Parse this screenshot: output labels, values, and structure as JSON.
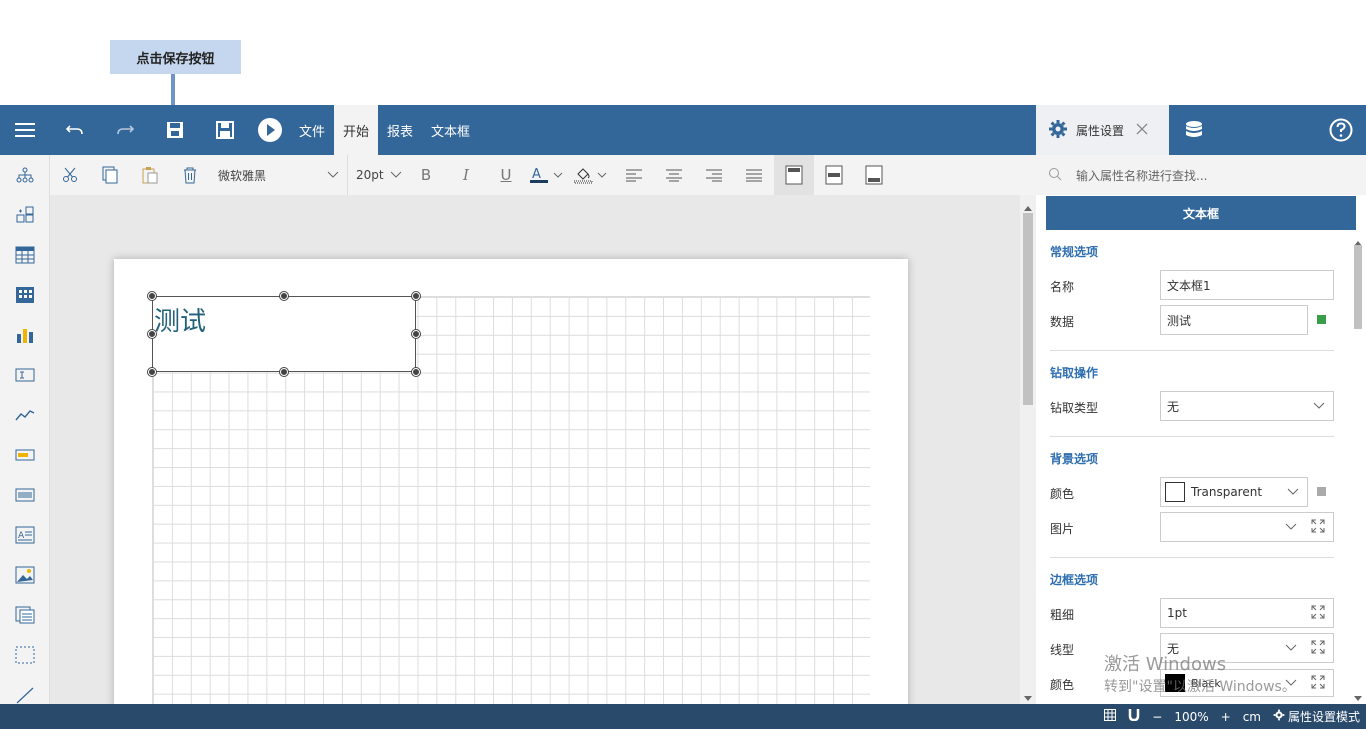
{
  "callout": {
    "text": "点击保存按钮"
  },
  "topbar": {
    "menu_file": "文件",
    "tab_start": "开始",
    "tab_report": "报表",
    "tab_textbox": "文本框"
  },
  "right_tabs": {
    "properties_label": "属性设置"
  },
  "ribbon": {
    "font_name": "微软雅黑",
    "font_size": "20pt"
  },
  "canvas": {
    "textbox_text": "测试"
  },
  "panel": {
    "search_placeholder": "输入属性名称进行查找...",
    "title": "文本框",
    "general": {
      "heading": "常规选项",
      "name_label": "名称",
      "name_value": "文本框1",
      "data_label": "数据",
      "data_value": "测试"
    },
    "drill": {
      "heading": "钻取操作",
      "type_label": "钻取类型",
      "type_value": "无"
    },
    "background": {
      "heading": "背景选项",
      "color_label": "颜色",
      "color_value": "Transparent",
      "image_label": "图片",
      "image_value": ""
    },
    "border": {
      "heading": "边框选项",
      "width_label": "粗细",
      "width_value": "1pt",
      "style_label": "线型",
      "style_value": "无",
      "color_label": "颜色",
      "color_value": "Black"
    }
  },
  "statusbar": {
    "minus": "−",
    "zoom": "100%",
    "plus": "+",
    "unit": "cm",
    "mode": "属性设置模式"
  },
  "watermark": {
    "line1": "激活 Windows",
    "line2": "转到\"设置\"以激活 Windows。"
  },
  "colors": {
    "primary": "#346799",
    "status": "#2a4a6b",
    "accent": "#2f6eb0",
    "green": "#3a9d4a"
  }
}
